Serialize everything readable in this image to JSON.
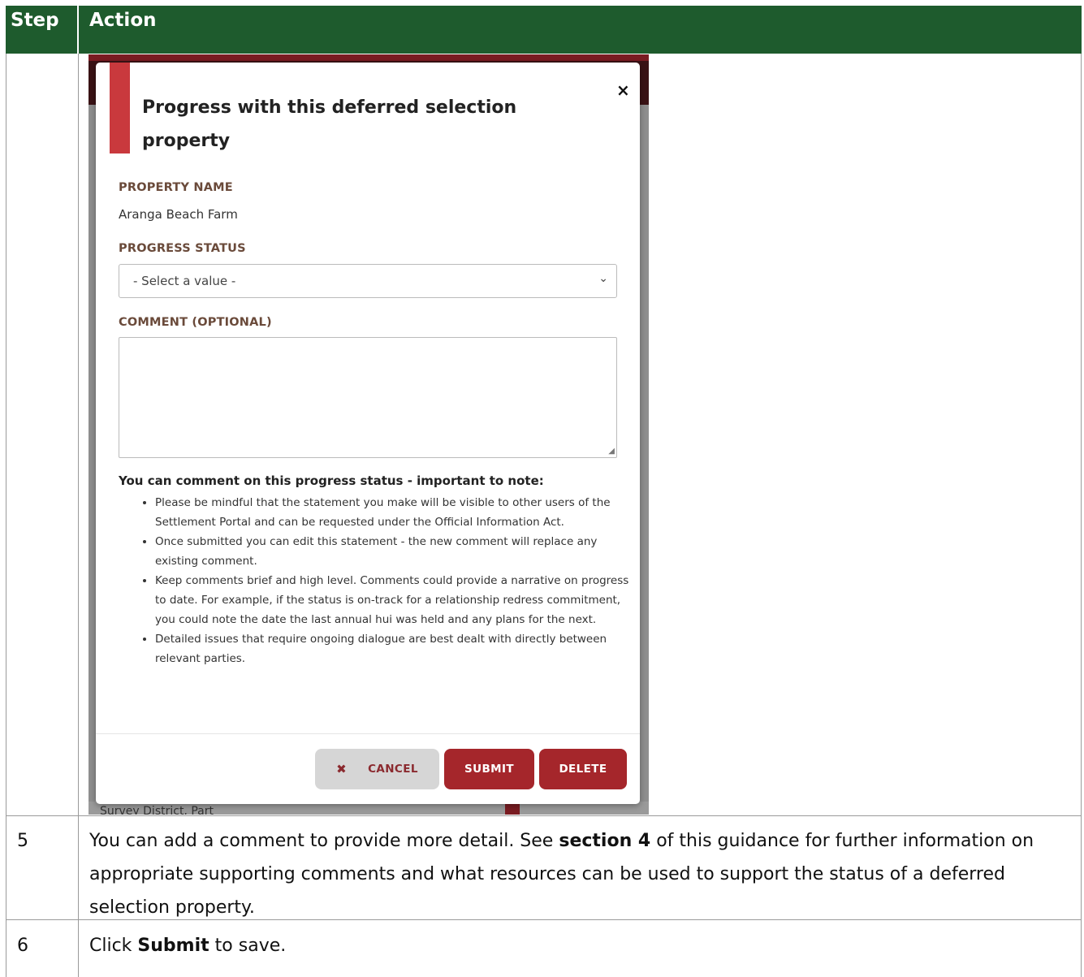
{
  "table": {
    "header": {
      "step": "Step",
      "action": "Action"
    },
    "rows": [
      {
        "step": "5",
        "text_before": "You can add a comment to provide more detail. See ",
        "bold": "section 4",
        "text_after": " of this guidance for further information on appropriate supporting comments and what resources can be used to support the status of a deferred selection property."
      },
      {
        "step": "6",
        "text_before": "Click ",
        "bold": "Submit",
        "text_after": " to save."
      }
    ]
  },
  "modal": {
    "title": "Progress with this deferred selection property",
    "close": "×",
    "property_name_label": "PROPERTY NAME",
    "property_name_value": "Aranga Beach Farm",
    "progress_status_label": "PROGRESS STATUS",
    "progress_status_placeholder": "- Select a value -",
    "comment_label": "COMMENT (OPTIONAL)",
    "note_title": "You can comment on this progress status - important to note:",
    "notes": [
      "Please be mindful that the statement you make will be visible to other users of the Settlement Portal and can be requested under the Official Information Act.",
      "Once submitted you can edit this statement - the new comment will replace any existing comment.",
      "Keep comments brief and high level. Comments could provide a narrative on progress to date. For example, if the status is on-track for a relationship redress commitment, you could note the date the last annual hui was held and any plans for the next.",
      "Detailed issues that require ongoing dialogue are best dealt with directly between relevant parties."
    ],
    "buttons": {
      "cancel": "CANCEL",
      "submit": "SUBMIT",
      "delete": "DELETE"
    }
  },
  "backdrop": {
    "bottom_text": "Survey District, Part"
  }
}
